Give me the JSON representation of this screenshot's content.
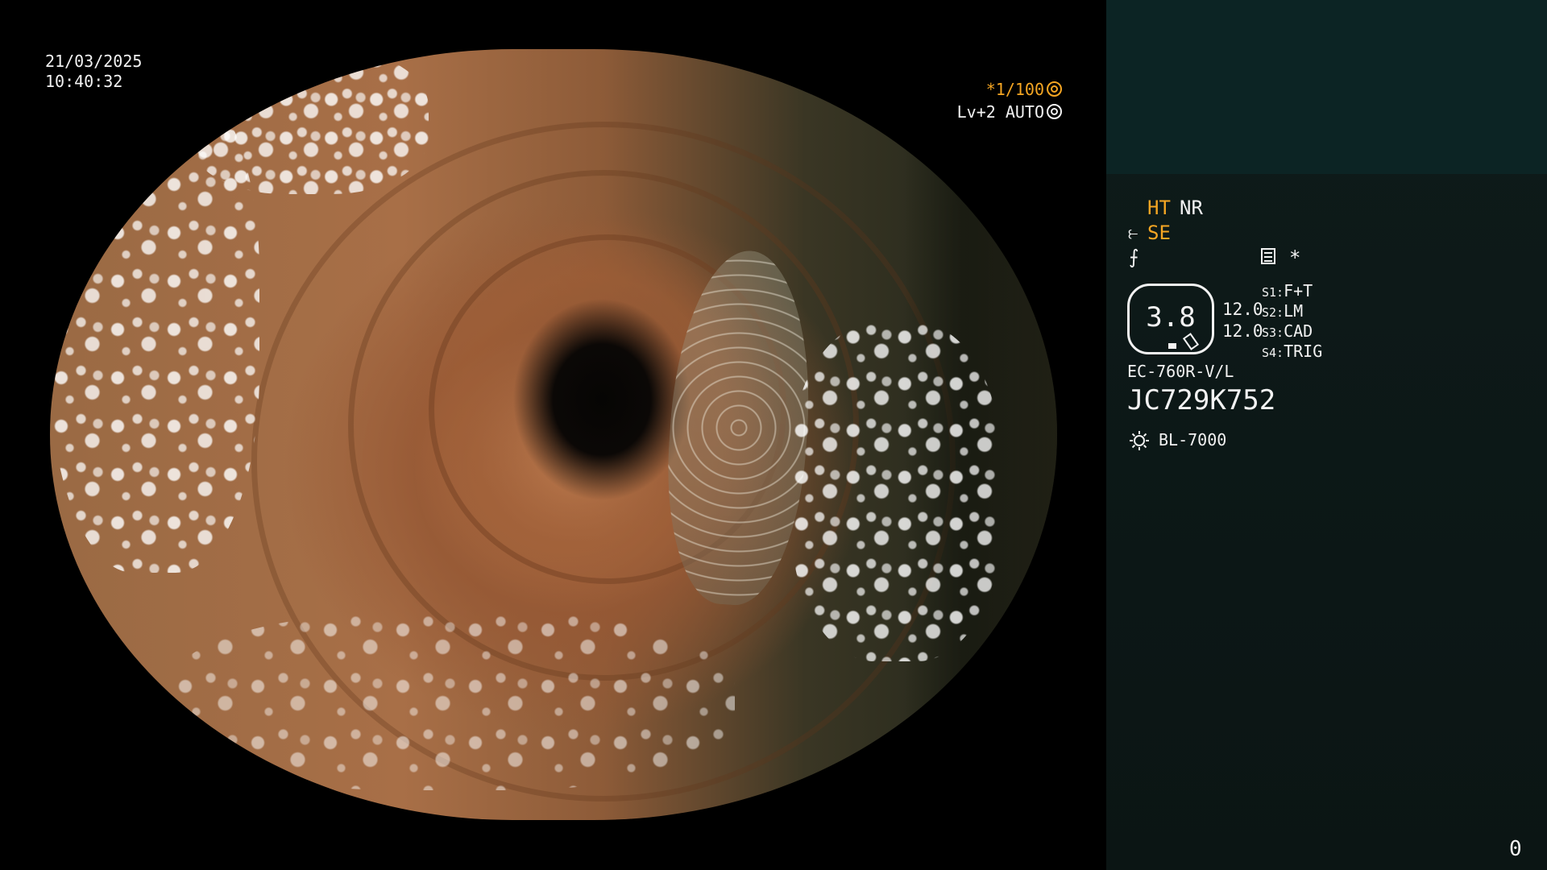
{
  "overlay": {
    "date": "21/03/2025",
    "time": "10:40:32",
    "shutter": "*1/100",
    "level": "Lv+2 AUTO"
  },
  "panel": {
    "ht": "HT",
    "nr": "NR",
    "se": "SE",
    "star": "*",
    "zoom_value": "3.8",
    "value_top": "12.0",
    "value_bottom": "12.0",
    "switches": [
      {
        "key": "S1:",
        "value": "F+T"
      },
      {
        "key": "S2:",
        "value": "LM"
      },
      {
        "key": "S3:",
        "value": "CAD"
      },
      {
        "key": "S4:",
        "value": "TRIG"
      }
    ],
    "scope_model": "EC-760R-V/L",
    "serial": "JC729K752",
    "light_source": "BL-7000",
    "counter": "0"
  },
  "colors": {
    "accent": "#f5a623",
    "panel_bg": "#0b1514",
    "thumb_bg": "#0c2424",
    "text": "#f2f2f2"
  },
  "icons": [
    "aperture-icon",
    "iris-icon",
    "structure-enhance-icon",
    "edge-icon",
    "document-icon",
    "zoom-lever-icon",
    "light-source-icon"
  ]
}
